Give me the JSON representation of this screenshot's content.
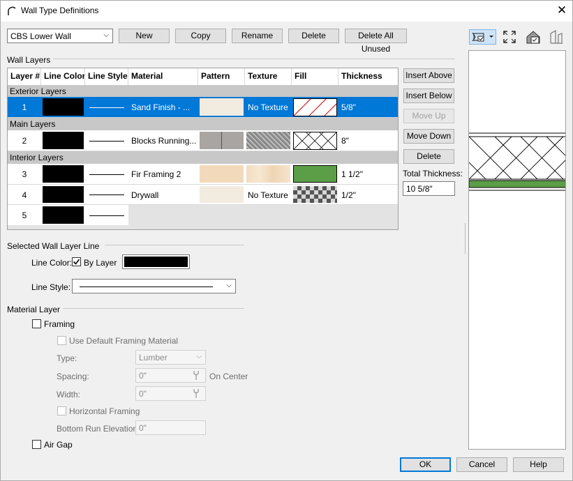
{
  "window": {
    "title": "Wall Type Definitions"
  },
  "toolbar": {
    "wall_type": "CBS Lower Wall",
    "new": "New",
    "copy": "Copy",
    "rename": "Rename",
    "delete": "Delete",
    "delete_all_unused": "Delete All Unused"
  },
  "wall_layers": {
    "section_label": "Wall Layers",
    "columns": [
      "Layer #",
      "Line Color",
      "Line Style",
      "Material",
      "Pattern",
      "Texture",
      "Fill",
      "Thickness"
    ],
    "groups": {
      "exterior": "Exterior Layers",
      "main": "Main Layers",
      "interior": "Interior Layers"
    },
    "rows": [
      {
        "num": "1",
        "line_color": "#000000",
        "material": "Sand Finish - ...",
        "pattern_color": "#f2ebe0",
        "texture": "No Texture",
        "fill": "diagonal-hatch",
        "thickness": "5/8\""
      },
      {
        "num": "2",
        "line_color": "#000000",
        "material": "Blocks Running...",
        "pattern_color": "#a8a5a2",
        "texture": "",
        "fill": "crosshatch",
        "thickness": "8\""
      },
      {
        "num": "3",
        "line_color": "#000000",
        "material": "Fir Framing 2",
        "pattern_color": "#f3d9bb",
        "texture": "",
        "fill": "solid-green",
        "thickness": "1 1/2\""
      },
      {
        "num": "4",
        "line_color": "#000000",
        "material": "Drywall",
        "pattern_color": "#f2ebe0",
        "texture": "No Texture",
        "fill": "checker",
        "thickness": "1/2\""
      },
      {
        "num": "5",
        "line_color": "#000000",
        "material": "",
        "pattern_color": "",
        "texture": "",
        "fill": "",
        "thickness": ""
      }
    ]
  },
  "side_buttons": {
    "insert_above": "Insert Above",
    "insert_below": "Insert Below",
    "move_up": "Move Up",
    "move_down": "Move Down",
    "delete": "Delete",
    "total_label": "Total Thickness:",
    "total_value": "10 5/8\""
  },
  "wall_layer_line": {
    "section_label": "Selected Wall Layer Line",
    "line_color_label": "Line Color:",
    "by_layer_label": "By Layer",
    "by_layer_checked": true,
    "color": "#000000",
    "line_style_label": "Line Style:"
  },
  "material_layer": {
    "section_label": "Material Layer",
    "framing_label": "Framing",
    "use_default_label": "Use Default Framing Material",
    "type_label": "Type:",
    "type_value": "Lumber",
    "spacing_label": "Spacing:",
    "spacing_value": "0\"",
    "on_center_label": "On Center",
    "width_label": "Width:",
    "width_value": "0\"",
    "horizontal_label": "Horizontal Framing",
    "bottom_run_label": "Bottom Run Elevation:",
    "bottom_run_value": "0\"",
    "air_gap_label": "Air Gap"
  },
  "footer": {
    "ok": "OK",
    "cancel": "Cancel",
    "help": "Help"
  },
  "colors": {
    "accent": "#0078d7",
    "fill_green": "#5c9e47"
  },
  "icons": [
    "app-arc-icon",
    "close-icon",
    "wall-view-icon",
    "fill-window-icon",
    "house-check-icon",
    "wall-section-icon"
  ]
}
